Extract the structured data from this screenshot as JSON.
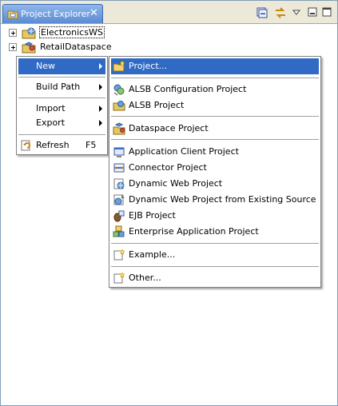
{
  "view": {
    "tab_title": "Project Explorer",
    "tab_close": "✕",
    "toolbar": [
      "collapse-all-icon",
      "link-with-editor-icon",
      "view-menu-icon",
      "minimize-icon",
      "maximize-icon"
    ]
  },
  "tree": {
    "items": [
      {
        "label": "ElectronicsWS",
        "expander": "+",
        "icon": "web-service-project-icon"
      },
      {
        "label": "RetailDataspace",
        "expander": "+",
        "icon": "dataspace-project-icon"
      }
    ]
  },
  "context_menu": {
    "items": [
      {
        "label": "New",
        "submenu": true,
        "selected": true
      },
      {
        "label": "Build Path",
        "submenu": true
      },
      {
        "label": "Import",
        "submenu": true
      },
      {
        "label": "Export",
        "submenu": true
      },
      {
        "label": "Refresh",
        "accelerator": "F5",
        "icon": "refresh-icon"
      }
    ]
  },
  "new_submenu": {
    "items": [
      {
        "label": "Project...",
        "icon": "new-project-icon",
        "selected": true
      },
      {
        "label": "ALSB Configuration Project",
        "icon": "alsb-config-icon"
      },
      {
        "label": "ALSB Project",
        "icon": "alsb-project-icon"
      },
      {
        "label": "Dataspace Project",
        "icon": "dataspace-project-icon"
      },
      {
        "label": "Application Client Project",
        "icon": "app-client-icon"
      },
      {
        "label": "Connector Project",
        "icon": "connector-icon"
      },
      {
        "label": "Dynamic Web Project",
        "icon": "dynamic-web-icon"
      },
      {
        "label": "Dynamic Web Project from Existing Source",
        "icon": "dynamic-web-existing-icon"
      },
      {
        "label": "EJB Project",
        "icon": "ejb-icon"
      },
      {
        "label": "Enterprise Application Project",
        "icon": "ear-icon"
      },
      {
        "label": "Example...",
        "icon": "example-icon"
      },
      {
        "label": "Other...",
        "icon": "other-wizard-icon"
      }
    ]
  },
  "colors": {
    "selection": "#316ac5",
    "tab_gradient_top": "#8fb6ec",
    "tab_gradient_bottom": "#5b8bd5",
    "menu_border": "#808080"
  }
}
